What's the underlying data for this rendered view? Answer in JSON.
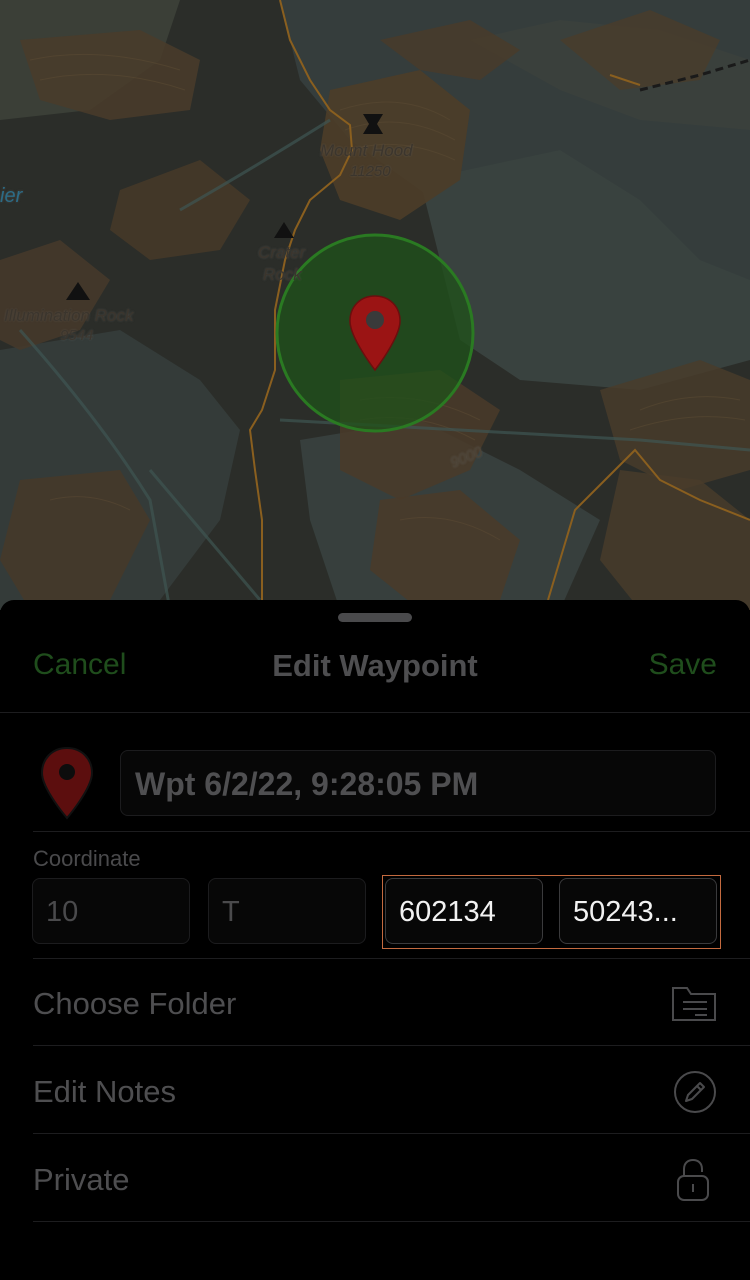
{
  "map": {
    "labels": {
      "mount_hood_name": "Mount Hood",
      "mount_hood_elev": "11250",
      "crater_name_1": "Crater",
      "crater_name_2": "Rock",
      "illumination_name": "Illumination Rock",
      "illumination_elev": "9544",
      "water_partial": "ier",
      "contour_elev": "9000"
    },
    "colors": {
      "terrain": "#2b2d29",
      "snow": "#38413f",
      "trail": "#8a5f1f",
      "rock": "#4a3c2a",
      "radius_fill": "#1f5119",
      "radius_stroke": "#2a7a22",
      "pin": "#9b1414"
    }
  },
  "sheet": {
    "cancel_label": "Cancel",
    "title": "Edit Waypoint",
    "save_label": "Save",
    "waypoint_icon": "map-pin-icon",
    "waypoint_name": "Wpt 6/2/22, 9:28:05 PM",
    "coordinate_label": "Coordinate",
    "coordinate": {
      "zone": "10",
      "band": "T",
      "easting": "602134",
      "northing": "50243..."
    },
    "rows": [
      {
        "label": "Choose Folder",
        "icon": "folder-icon"
      },
      {
        "label": "Edit Notes",
        "icon": "pencil-icon"
      },
      {
        "label": "Private",
        "icon": "lock-icon"
      }
    ],
    "colors": {
      "accent_green": "#1f4d1c",
      "highlight_border": "#c46a3f"
    }
  }
}
